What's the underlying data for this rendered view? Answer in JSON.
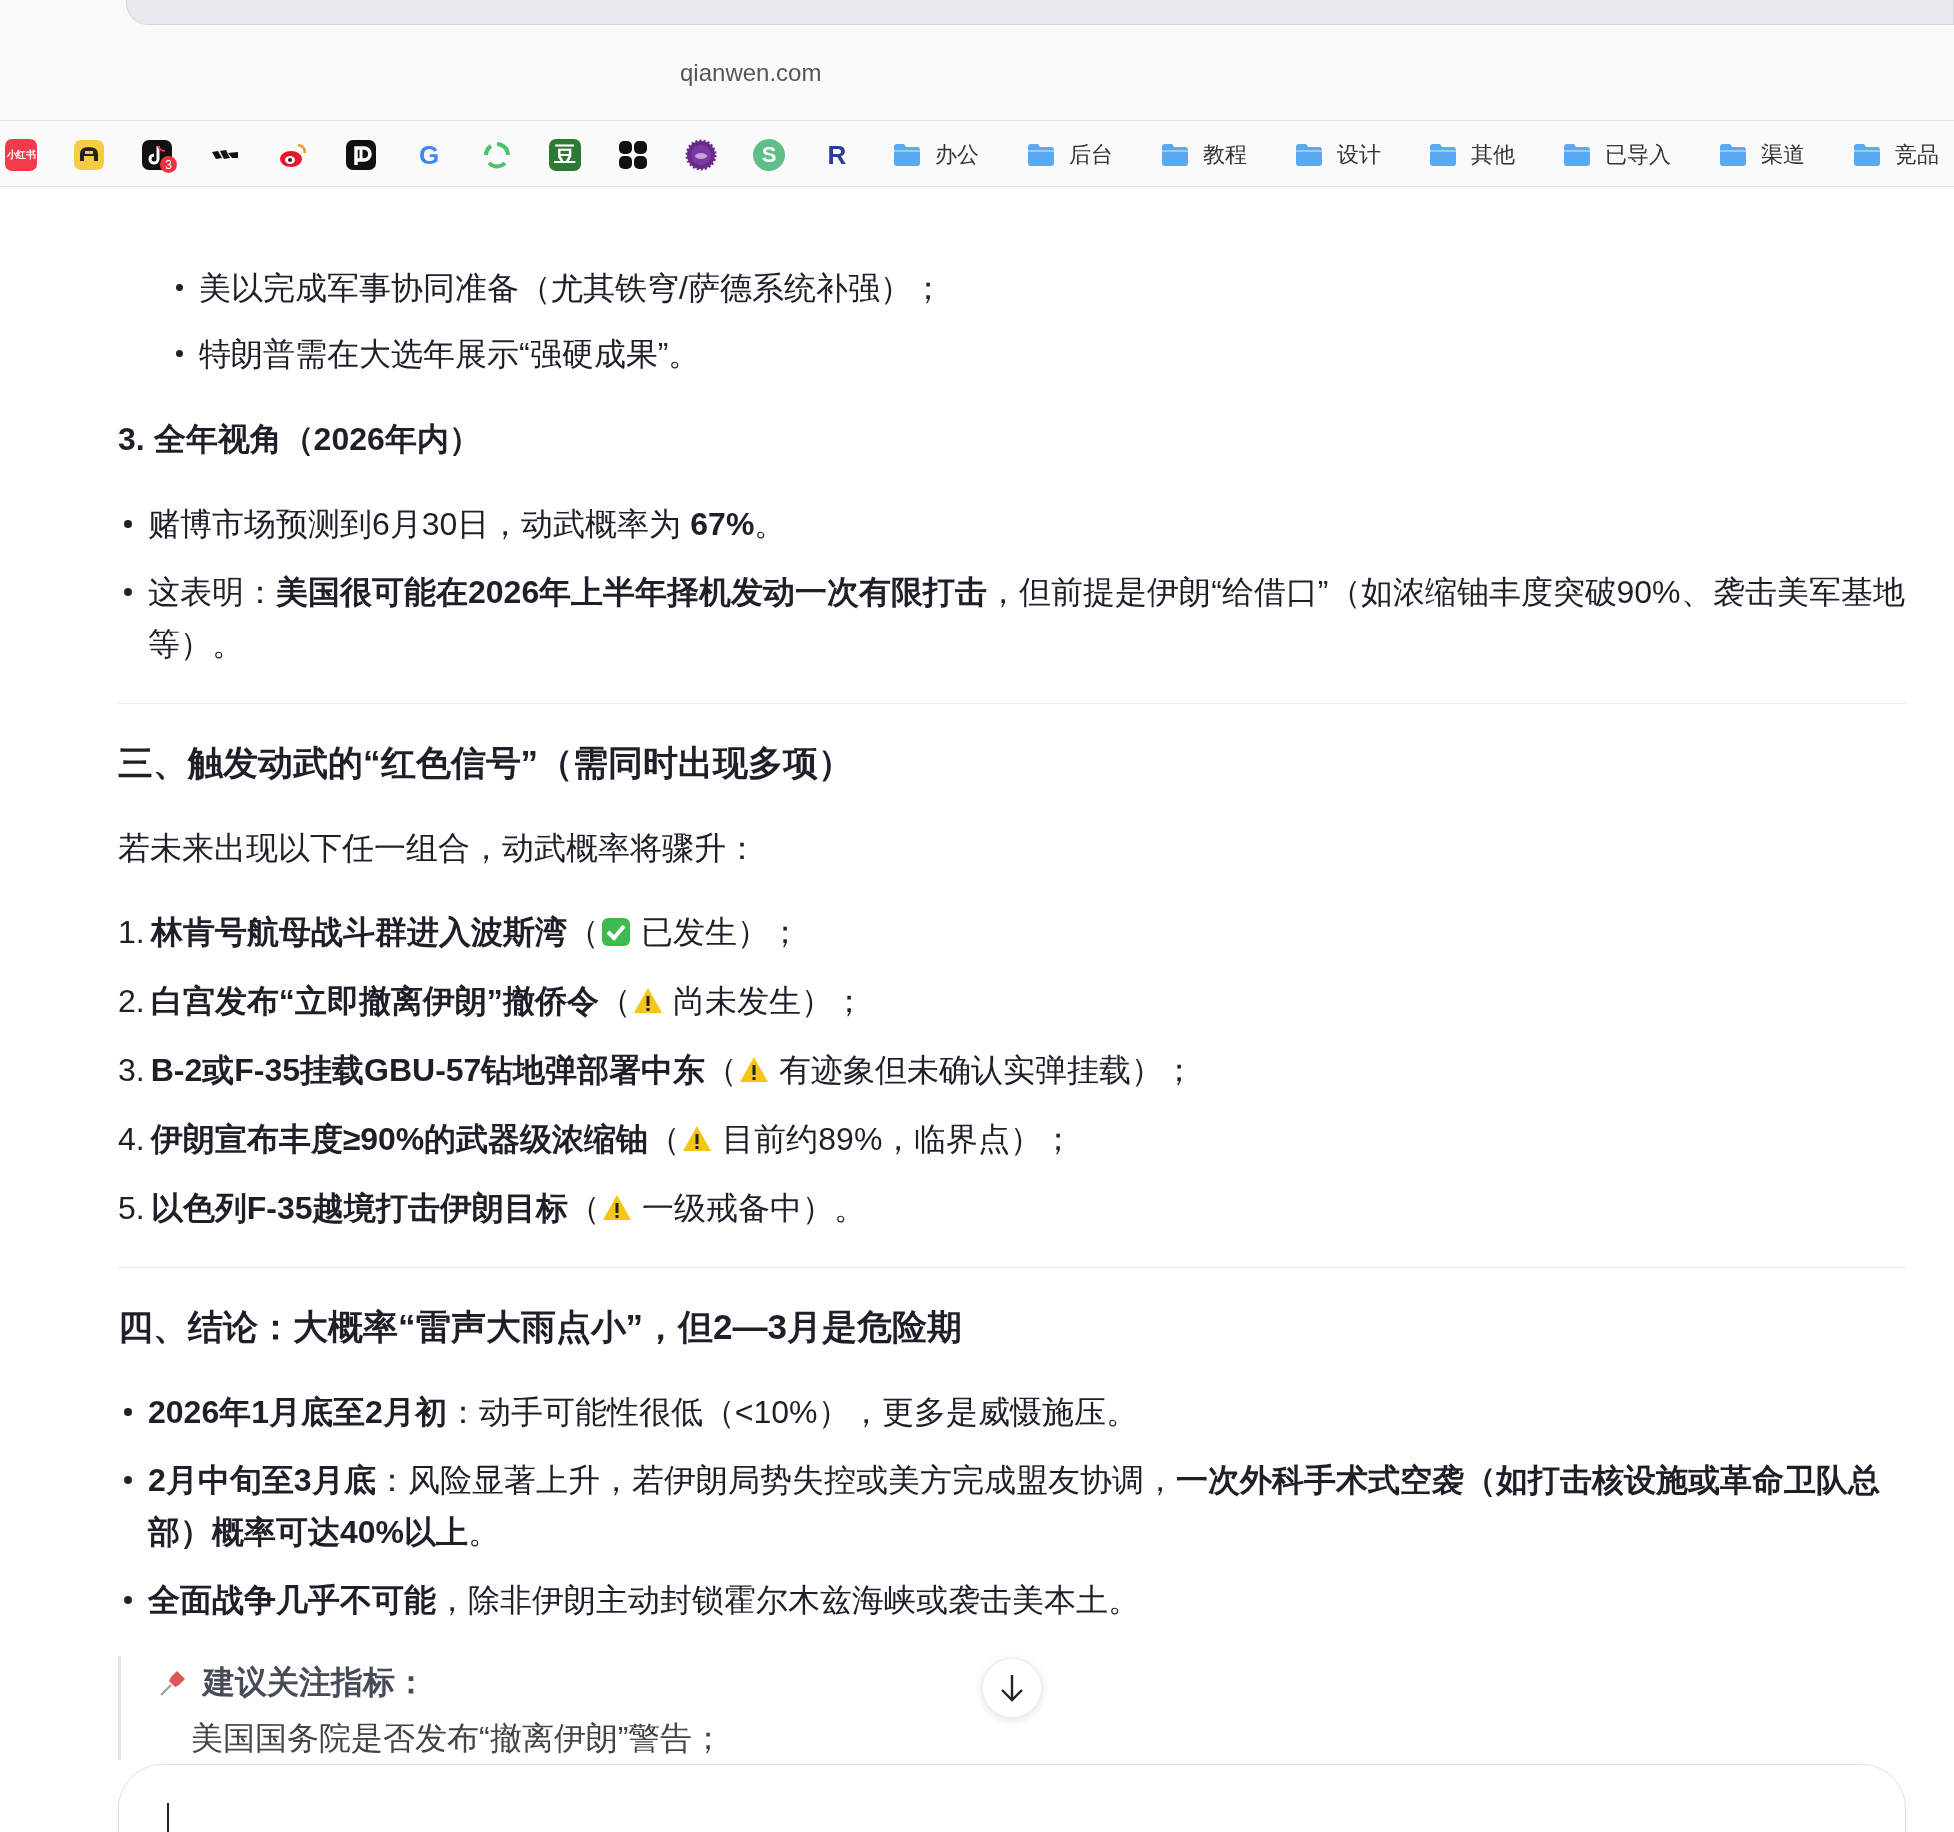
{
  "browser": {
    "address": "qianwen.com",
    "apps": [
      {
        "kind": "text_tile",
        "text": "小红书"
      },
      {
        "kind": "car"
      },
      {
        "kind": "note",
        "badge": "3"
      },
      {
        "kind": "stripes"
      },
      {
        "kind": "eye"
      },
      {
        "kind": "p_logo"
      },
      {
        "kind": "letter_tile",
        "text": "G"
      },
      {
        "kind": "recycle"
      },
      {
        "kind": "char_tile",
        "text": "豆"
      },
      {
        "kind": "grid"
      },
      {
        "kind": "spiky"
      },
      {
        "kind": "circle_letter",
        "text": "S"
      },
      {
        "kind": "letter_tile",
        "text": "R"
      }
    ],
    "folders": [
      "办公",
      "后台",
      "教程",
      "设计",
      "其他",
      "已导入",
      "渠道",
      "竞品"
    ]
  },
  "content": [
    {
      "kind": "sub_bullet",
      "text": "美以完成军事协同准备（尤其铁穹/萨德系统补强）；"
    },
    {
      "kind": "sub_bullet",
      "text": "特朗普需在大选年展示“强硬成果”。"
    },
    {
      "kind": "subheading",
      "text": "3. 全年视角（2026年内）"
    },
    {
      "kind": "bullet",
      "text": "赌博市场预测到6月30日，动武概率为 **67%**。"
    },
    {
      "kind": "bullet",
      "text": "这表明：**美国很可能在2026年上半年择机发动一次有限打击**，但前提是伊朗“给借口”（如浓缩铀丰度突破90%、袭击美军基地等）。"
    },
    {
      "kind": "rule"
    },
    {
      "kind": "heading",
      "text": "三、触发动武的“红色信号”（需同时出现多项）"
    },
    {
      "kind": "paragraph",
      "text": "若未来出现以下任一组合，动武概率将骤升："
    },
    {
      "kind": "numbered",
      "number": "1.",
      "text": "**林肯号航母战斗群进入波斯湾**（",
      "confirmed": true,
      "note": "已发生）；"
    },
    {
      "kind": "numbered",
      "number": "2.",
      "text": "**白宫发布“立即撤离伊朗”撤侨令**（",
      "confirmed": false,
      "note": "尚未发生）；"
    },
    {
      "kind": "numbered",
      "number": "3.",
      "text": "**B-2或F-35挂载GBU-57钻地弹部署中东**（",
      "confirmed": false,
      "note": "有迹象但未确认实弹挂载）；"
    },
    {
      "kind": "numbered",
      "number": "4.",
      "text": "**伊朗宣布丰度≥90%的武器级浓缩铀**（",
      "confirmed": false,
      "note": "目前约89%，临界点）；"
    },
    {
      "kind": "numbered",
      "number": "5.",
      "text": "**以色列F-35越境打击伊朗目标**（",
      "confirmed": false,
      "note": "一级戒备中）。"
    },
    {
      "kind": "rule"
    },
    {
      "kind": "heading",
      "text": "四、结论：大概率“雷声大雨点小”，但2—3月是危险期"
    },
    {
      "kind": "bullet",
      "text": "**2026年1月底至2月初**：动手可能性很低（<10%），更多是威慑施压。"
    },
    {
      "kind": "bullet",
      "text": "**2月中旬至3月底**：风险显著上升，若伊朗局势失控或美方完成盟友协调，**一次外科手术式空袭（如打击核设施或革命卫队总部）概率可达40%以上**。"
    },
    {
      "kind": "bullet",
      "text": "**全面战争几乎不可能**，除非伊朗主动封锁霍尔木兹海峡或袭击美本土。"
    },
    {
      "kind": "callout",
      "title": "建议关注指标：",
      "items": [
        "美国国务院是否发布“撤离伊朗”警告；"
      ]
    }
  ]
}
